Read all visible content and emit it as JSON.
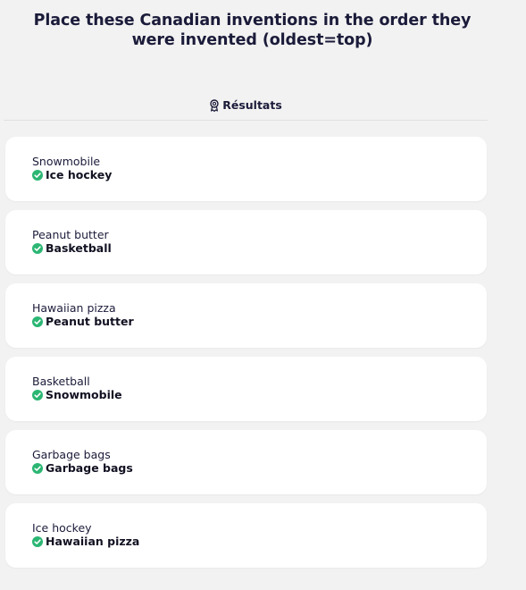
{
  "question": {
    "line1": "Place these Canadian inventions in the order they",
    "line2": "were invented (oldest=top)"
  },
  "results": {
    "label": "Résultats",
    "icon": "award-ribbon-icon"
  },
  "status_color": "#2bb673",
  "items": [
    {
      "placed": "Snowmobile",
      "answer": "Ice hockey",
      "status": "correct",
      "icon": "check-circle-icon"
    },
    {
      "placed": "Peanut butter",
      "answer": "Basketball",
      "status": "correct",
      "icon": "check-circle-icon"
    },
    {
      "placed": "Hawaiian pizza",
      "answer": "Peanut butter",
      "status": "correct",
      "icon": "check-circle-icon"
    },
    {
      "placed": "Basketball",
      "answer": "Snowmobile",
      "status": "correct",
      "icon": "check-circle-icon"
    },
    {
      "placed": "Garbage bags",
      "answer": "Garbage bags",
      "status": "correct",
      "icon": "check-circle-icon"
    },
    {
      "placed": "Ice hockey",
      "answer": "Hawaiian pizza",
      "status": "correct",
      "icon": "check-circle-icon"
    }
  ]
}
